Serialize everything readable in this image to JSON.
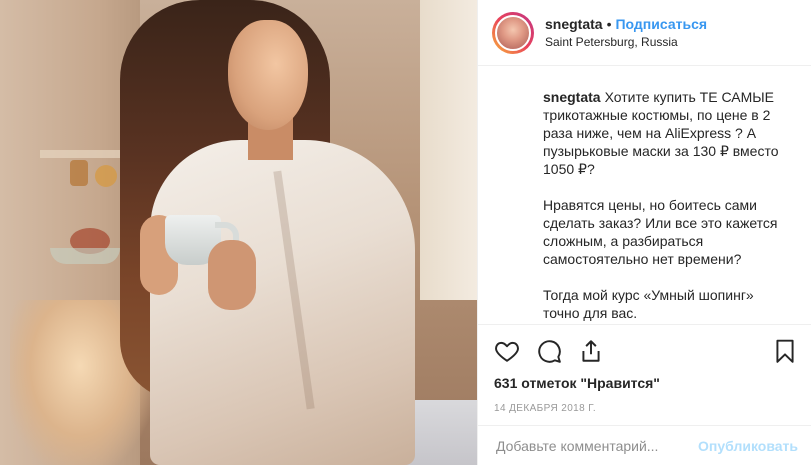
{
  "header": {
    "username": "snegtata",
    "separator": "•",
    "follow_label": "Подписаться",
    "location": "Saint Petersburg, Russia"
  },
  "caption": {
    "username": "snegtata",
    "paragraph1": "Хотите купить ТЕ САМЫЕ трикотажные костюмы, по цене в 2 раза ниже, чем на AliExpress ? А пузырьковые маски за 130 ₽ вместо 1050 ₽?",
    "paragraph2": "Нравятся цены, но боитесь сами сделать заказ? Или все это кажется сложным, а разбираться самостоятельно нет времени?",
    "paragraph3": "Тогда мой курс «Умный шопинг» точно для вас."
  },
  "actions": {
    "icons": [
      "heart-icon",
      "comment-icon",
      "share-icon",
      "bookmark-icon"
    ]
  },
  "likes": "631 отметок \"Нравится\"",
  "date": "14 ДЕКАБРЯ 2018 Г.",
  "comment": {
    "placeholder": "Добавьте комментарий...",
    "value": "",
    "publish_label": "Опубликовать"
  },
  "colors": {
    "accent": "#3897f0",
    "publish_disabled": "#b2dffc",
    "border": "#efefef",
    "text": "#262626",
    "muted": "#999999"
  }
}
